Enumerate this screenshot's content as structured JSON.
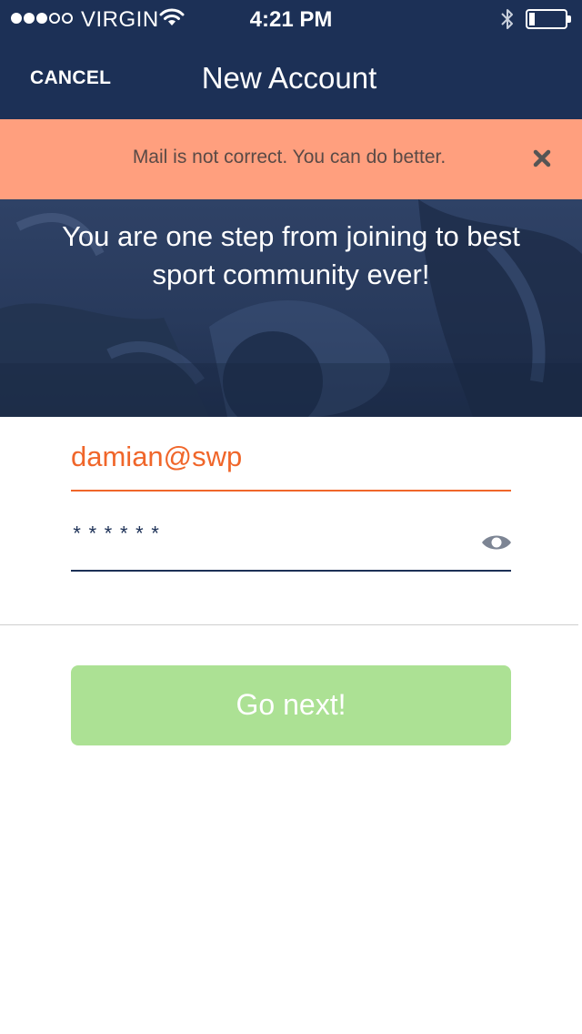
{
  "status_bar": {
    "carrier": "VIRGIN",
    "time": "4:21 PM",
    "signal_bars_filled": 3,
    "signal_bars_total": 5,
    "battery_level": 0.12,
    "icons": [
      "wifi-icon",
      "bluetooth-icon",
      "battery-icon"
    ]
  },
  "nav": {
    "cancel_label": "CANCEL",
    "title": "New Account"
  },
  "error_banner": {
    "message": "Mail is not correct. You can do better.",
    "close_icon": "close-icon"
  },
  "hero": {
    "text": "You are one step from joining to best sport community ever!"
  },
  "form": {
    "email_value": "damian@swp",
    "password_value": "******",
    "reveal_icon": "eye-icon"
  },
  "actions": {
    "go_next_label": "Go next!"
  },
  "colors": {
    "navy": "#1c3056",
    "error_banner_bg": "#ff9f7e",
    "error_accent": "#f0662a",
    "button_disabled_green": "#ace194"
  }
}
